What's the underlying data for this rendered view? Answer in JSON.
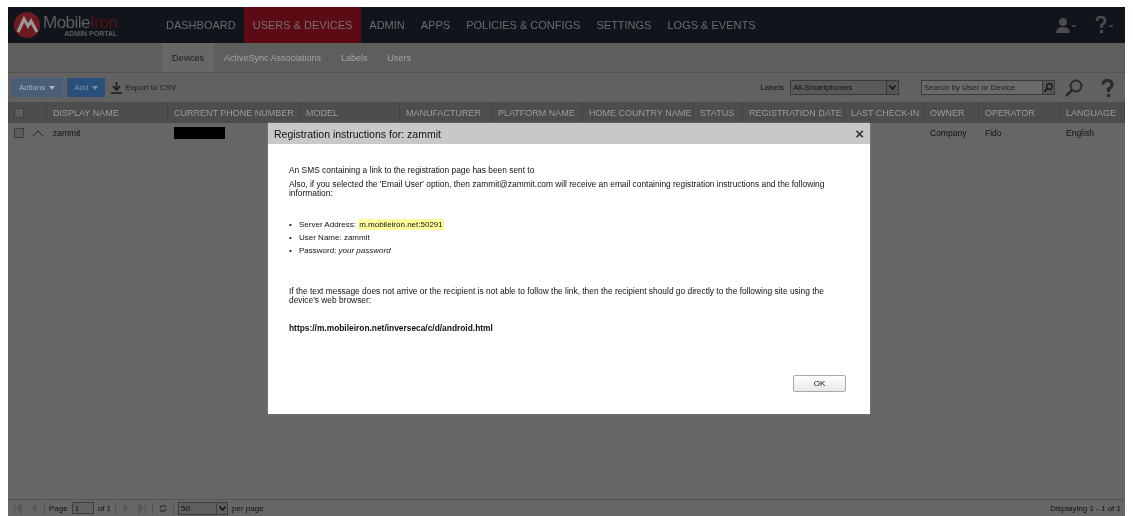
{
  "header": {
    "logo": {
      "word1": "Mobile",
      "word2": "Iron",
      "subtitle": "ADMIN PORTAL"
    },
    "nav": [
      {
        "label": "DASHBOARD",
        "selected": false
      },
      {
        "label": "USERS & DEVICES",
        "selected": true
      },
      {
        "label": "ADMIN",
        "selected": false
      },
      {
        "label": "APPS",
        "selected": false
      },
      {
        "label": "POLICIES & CONFIGS",
        "selected": false
      },
      {
        "label": "SETTINGS",
        "selected": false
      },
      {
        "label": "LOGS & EVENTS",
        "selected": false
      }
    ]
  },
  "subnav": [
    {
      "label": "Devices",
      "selected": true
    },
    {
      "label": "ActiveSync Associations",
      "selected": false
    },
    {
      "label": "Labels",
      "selected": false
    },
    {
      "label": "Users",
      "selected": false
    }
  ],
  "toolbar": {
    "buttons": [
      {
        "label": "Actions",
        "disabled": true
      },
      {
        "label": "Add",
        "disabled": false
      }
    ],
    "export": "Export to CSV",
    "labels_label": "Labels",
    "labels_value": "All-Smartphones",
    "search": {
      "placeholder": "Search by User or Device"
    }
  },
  "table": {
    "select_all_checked": false,
    "columns": [
      "DISPLAY NAME",
      "CURRENT PHONE NUMBER",
      "MODEL",
      "MANUFACTURER",
      "PLATFORM NAME",
      "HOME COUNTRY NAME",
      "STATUS",
      "REGISTRATION DATE",
      "LAST CHECK-IN",
      "OWNER",
      "OPERATOR",
      "LANGUAGE"
    ],
    "rows": [
      {
        "checked": false,
        "cells": [
          {
            "kind": "text",
            "text": "zammit"
          },
          {
            "kind": "redacted"
          },
          {
            "kind": "covered"
          },
          {
            "kind": "covered"
          },
          {
            "kind": "covered"
          },
          {
            "kind": "covered"
          },
          {
            "kind": "covered"
          },
          {
            "kind": "covered"
          },
          {
            "kind": "covered"
          },
          {
            "kind": "text",
            "text": "Company"
          },
          {
            "kind": "text",
            "text": "Fido"
          },
          {
            "kind": "text",
            "text": "English"
          }
        ]
      }
    ]
  },
  "pager": {
    "page_label": "Page",
    "page_value": "1",
    "of": "of 1",
    "page_size": "50",
    "per_page": "per page",
    "displaying": "Displaying 1 - 1 of 1"
  },
  "dialog": {
    "title": "Registration instructions for: zammit",
    "close": "×",
    "paragraphs": [
      "An SMS containing a link to the registration page has been sent to",
      "Also, if you selected the 'Email User' option, then zammit@zammit.com will receive an email containing registration instructions and the following information:"
    ],
    "items": [
      {
        "marker": "•",
        "label": "Server Address: ",
        "value": "m.mobileiron.net:50291",
        "highlighted": true
      },
      {
        "marker": "•",
        "label": "User Name: ",
        "value": "zammit",
        "highlighted": false
      },
      {
        "marker": "•",
        "label": "Password: ",
        "value": "*your password*",
        "highlighted": false
      }
    ],
    "note": "If the text message does not arrive or the recipient is not able to follow the link, then the recipient should go directly to the following site using the device's web browser:",
    "url": "https://m.mobileiron.net/inverseca/c/d/android.html",
    "ok": "OK"
  }
}
